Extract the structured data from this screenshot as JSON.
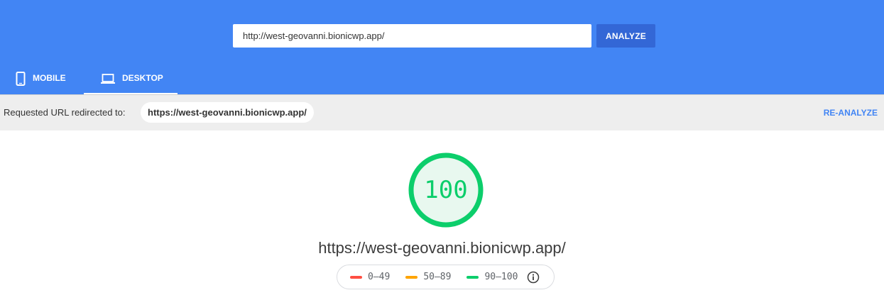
{
  "search": {
    "value": "http://west-geovanni.bionicwp.app/",
    "button_label": "ANALYZE"
  },
  "tabs": [
    {
      "label": "MOBILE",
      "icon": "phone-icon",
      "active": false
    },
    {
      "label": "DESKTOP",
      "icon": "laptop-icon",
      "active": true
    }
  ],
  "redirect": {
    "label": "Requested URL redirected to:",
    "url": "https://west-geovanni.bionicwp.app/",
    "reanalyze_label": "RE-ANALYZE"
  },
  "score": {
    "value": "100",
    "fraction": 1.0,
    "color": "#0cce6b"
  },
  "tested_url": "https://west-geovanni.bionicwp.app/",
  "legend": [
    {
      "range": "0–49",
      "color": "#ff4e42"
    },
    {
      "range": "50–89",
      "color": "#ffa400"
    },
    {
      "range": "90–100",
      "color": "#0cce6b"
    }
  ],
  "colors": {
    "header": "#4285f4",
    "analyze_button": "#3367d6",
    "redirect_bar": "#eeeeee"
  }
}
